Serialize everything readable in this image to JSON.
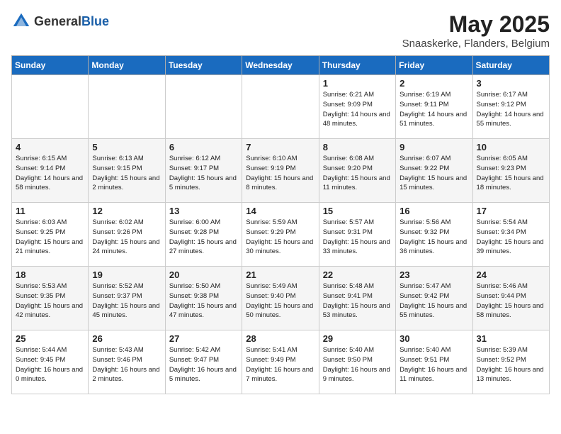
{
  "logo": {
    "general": "General",
    "blue": "Blue"
  },
  "title": "May 2025",
  "location": "Snaaskerke, Flanders, Belgium",
  "days_of_week": [
    "Sunday",
    "Monday",
    "Tuesday",
    "Wednesday",
    "Thursday",
    "Friday",
    "Saturday"
  ],
  "weeks": [
    [
      {
        "day": "",
        "info": ""
      },
      {
        "day": "",
        "info": ""
      },
      {
        "day": "",
        "info": ""
      },
      {
        "day": "",
        "info": ""
      },
      {
        "day": "1",
        "info": "Sunrise: 6:21 AM\nSunset: 9:09 PM\nDaylight: 14 hours\nand 48 minutes."
      },
      {
        "day": "2",
        "info": "Sunrise: 6:19 AM\nSunset: 9:11 PM\nDaylight: 14 hours\nand 51 minutes."
      },
      {
        "day": "3",
        "info": "Sunrise: 6:17 AM\nSunset: 9:12 PM\nDaylight: 14 hours\nand 55 minutes."
      }
    ],
    [
      {
        "day": "4",
        "info": "Sunrise: 6:15 AM\nSunset: 9:14 PM\nDaylight: 14 hours\nand 58 minutes."
      },
      {
        "day": "5",
        "info": "Sunrise: 6:13 AM\nSunset: 9:15 PM\nDaylight: 15 hours\nand 2 minutes."
      },
      {
        "day": "6",
        "info": "Sunrise: 6:12 AM\nSunset: 9:17 PM\nDaylight: 15 hours\nand 5 minutes."
      },
      {
        "day": "7",
        "info": "Sunrise: 6:10 AM\nSunset: 9:19 PM\nDaylight: 15 hours\nand 8 minutes."
      },
      {
        "day": "8",
        "info": "Sunrise: 6:08 AM\nSunset: 9:20 PM\nDaylight: 15 hours\nand 11 minutes."
      },
      {
        "day": "9",
        "info": "Sunrise: 6:07 AM\nSunset: 9:22 PM\nDaylight: 15 hours\nand 15 minutes."
      },
      {
        "day": "10",
        "info": "Sunrise: 6:05 AM\nSunset: 9:23 PM\nDaylight: 15 hours\nand 18 minutes."
      }
    ],
    [
      {
        "day": "11",
        "info": "Sunrise: 6:03 AM\nSunset: 9:25 PM\nDaylight: 15 hours\nand 21 minutes."
      },
      {
        "day": "12",
        "info": "Sunrise: 6:02 AM\nSunset: 9:26 PM\nDaylight: 15 hours\nand 24 minutes."
      },
      {
        "day": "13",
        "info": "Sunrise: 6:00 AM\nSunset: 9:28 PM\nDaylight: 15 hours\nand 27 minutes."
      },
      {
        "day": "14",
        "info": "Sunrise: 5:59 AM\nSunset: 9:29 PM\nDaylight: 15 hours\nand 30 minutes."
      },
      {
        "day": "15",
        "info": "Sunrise: 5:57 AM\nSunset: 9:31 PM\nDaylight: 15 hours\nand 33 minutes."
      },
      {
        "day": "16",
        "info": "Sunrise: 5:56 AM\nSunset: 9:32 PM\nDaylight: 15 hours\nand 36 minutes."
      },
      {
        "day": "17",
        "info": "Sunrise: 5:54 AM\nSunset: 9:34 PM\nDaylight: 15 hours\nand 39 minutes."
      }
    ],
    [
      {
        "day": "18",
        "info": "Sunrise: 5:53 AM\nSunset: 9:35 PM\nDaylight: 15 hours\nand 42 minutes."
      },
      {
        "day": "19",
        "info": "Sunrise: 5:52 AM\nSunset: 9:37 PM\nDaylight: 15 hours\nand 45 minutes."
      },
      {
        "day": "20",
        "info": "Sunrise: 5:50 AM\nSunset: 9:38 PM\nDaylight: 15 hours\nand 47 minutes."
      },
      {
        "day": "21",
        "info": "Sunrise: 5:49 AM\nSunset: 9:40 PM\nDaylight: 15 hours\nand 50 minutes."
      },
      {
        "day": "22",
        "info": "Sunrise: 5:48 AM\nSunset: 9:41 PM\nDaylight: 15 hours\nand 53 minutes."
      },
      {
        "day": "23",
        "info": "Sunrise: 5:47 AM\nSunset: 9:42 PM\nDaylight: 15 hours\nand 55 minutes."
      },
      {
        "day": "24",
        "info": "Sunrise: 5:46 AM\nSunset: 9:44 PM\nDaylight: 15 hours\nand 58 minutes."
      }
    ],
    [
      {
        "day": "25",
        "info": "Sunrise: 5:44 AM\nSunset: 9:45 PM\nDaylight: 16 hours\nand 0 minutes."
      },
      {
        "day": "26",
        "info": "Sunrise: 5:43 AM\nSunset: 9:46 PM\nDaylight: 16 hours\nand 2 minutes."
      },
      {
        "day": "27",
        "info": "Sunrise: 5:42 AM\nSunset: 9:47 PM\nDaylight: 16 hours\nand 5 minutes."
      },
      {
        "day": "28",
        "info": "Sunrise: 5:41 AM\nSunset: 9:49 PM\nDaylight: 16 hours\nand 7 minutes."
      },
      {
        "day": "29",
        "info": "Sunrise: 5:40 AM\nSunset: 9:50 PM\nDaylight: 16 hours\nand 9 minutes."
      },
      {
        "day": "30",
        "info": "Sunrise: 5:40 AM\nSunset: 9:51 PM\nDaylight: 16 hours\nand 11 minutes."
      },
      {
        "day": "31",
        "info": "Sunrise: 5:39 AM\nSunset: 9:52 PM\nDaylight: 16 hours\nand 13 minutes."
      }
    ]
  ]
}
